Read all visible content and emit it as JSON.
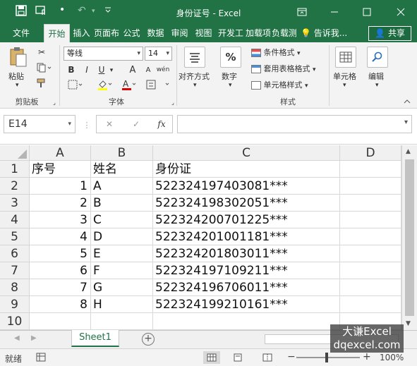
{
  "window": {
    "title": "身份证号 - Excel",
    "controls": {
      "ribbon_options": "▭",
      "minimize": "─",
      "maximize": "☐",
      "close": "✕"
    }
  },
  "quick_access": {
    "save": "💾",
    "touch": "☝",
    "dot": "•",
    "undo": "↶",
    "redo": "↷",
    "customize": "⌄"
  },
  "tabs": [
    {
      "label": "文件"
    },
    {
      "label": "开始"
    },
    {
      "label": "插入"
    },
    {
      "label": "页面布"
    },
    {
      "label": "公式"
    },
    {
      "label": "数据"
    },
    {
      "label": "审阅"
    },
    {
      "label": "视图"
    },
    {
      "label": "开发工"
    },
    {
      "label": "加载项"
    },
    {
      "label": "负载测"
    }
  ],
  "tell_me": "告诉我...",
  "share": "共享",
  "ribbon": {
    "clipboard": {
      "label": "剪贴板",
      "paste": "粘贴"
    },
    "font": {
      "label": "字体",
      "name": "等线",
      "size": "14",
      "bold": "B",
      "italic": "I",
      "underline": "U",
      "grow": "A",
      "shrink": "A",
      "wen": "wén"
    },
    "alignment": {
      "label": "对齐方式"
    },
    "number": {
      "label": "数字",
      "icon": "%"
    },
    "styles": {
      "label": "样式",
      "conditional": "条件格式",
      "table": "套用表格格式",
      "cell_styles": "单元格样式"
    },
    "cells": {
      "label": "单元格"
    },
    "editing": {
      "label": "编辑"
    }
  },
  "formula_bar": {
    "name_box": "E14",
    "cancel": "✕",
    "enter": "✓",
    "fx": "fx",
    "value": ""
  },
  "columns": [
    "A",
    "B",
    "C",
    "D"
  ],
  "rows": [
    {
      "num": "1",
      "a": "序号",
      "b": "姓名",
      "c": "身份证"
    },
    {
      "num": "2",
      "a": "1",
      "b": "A",
      "c": "522324197403081***"
    },
    {
      "num": "3",
      "a": "2",
      "b": "B",
      "c": "522324198302051***"
    },
    {
      "num": "4",
      "a": "3",
      "b": "C",
      "c": "522324200701225***"
    },
    {
      "num": "5",
      "a": "4",
      "b": "D",
      "c": "522324201001181***"
    },
    {
      "num": "6",
      "a": "5",
      "b": "E",
      "c": "522324201803011***"
    },
    {
      "num": "7",
      "a": "6",
      "b": "F",
      "c": "522324197109211***"
    },
    {
      "num": "8",
      "a": "7",
      "b": "G",
      "c": "522324196706011***"
    },
    {
      "num": "9",
      "a": "8",
      "b": "H",
      "c": "522324199210161***"
    },
    {
      "num": "10",
      "a": "",
      "b": "",
      "c": ""
    }
  ],
  "sheets": [
    {
      "name": "Sheet1"
    }
  ],
  "add_sheet": "+",
  "status": {
    "ready": "就绪",
    "zoom": "100%"
  },
  "watermark": {
    "line1": "大谦Excel",
    "line2": "dqexcel.com"
  },
  "colors": {
    "brand": "#217346",
    "grid": "#d8d8d8"
  }
}
